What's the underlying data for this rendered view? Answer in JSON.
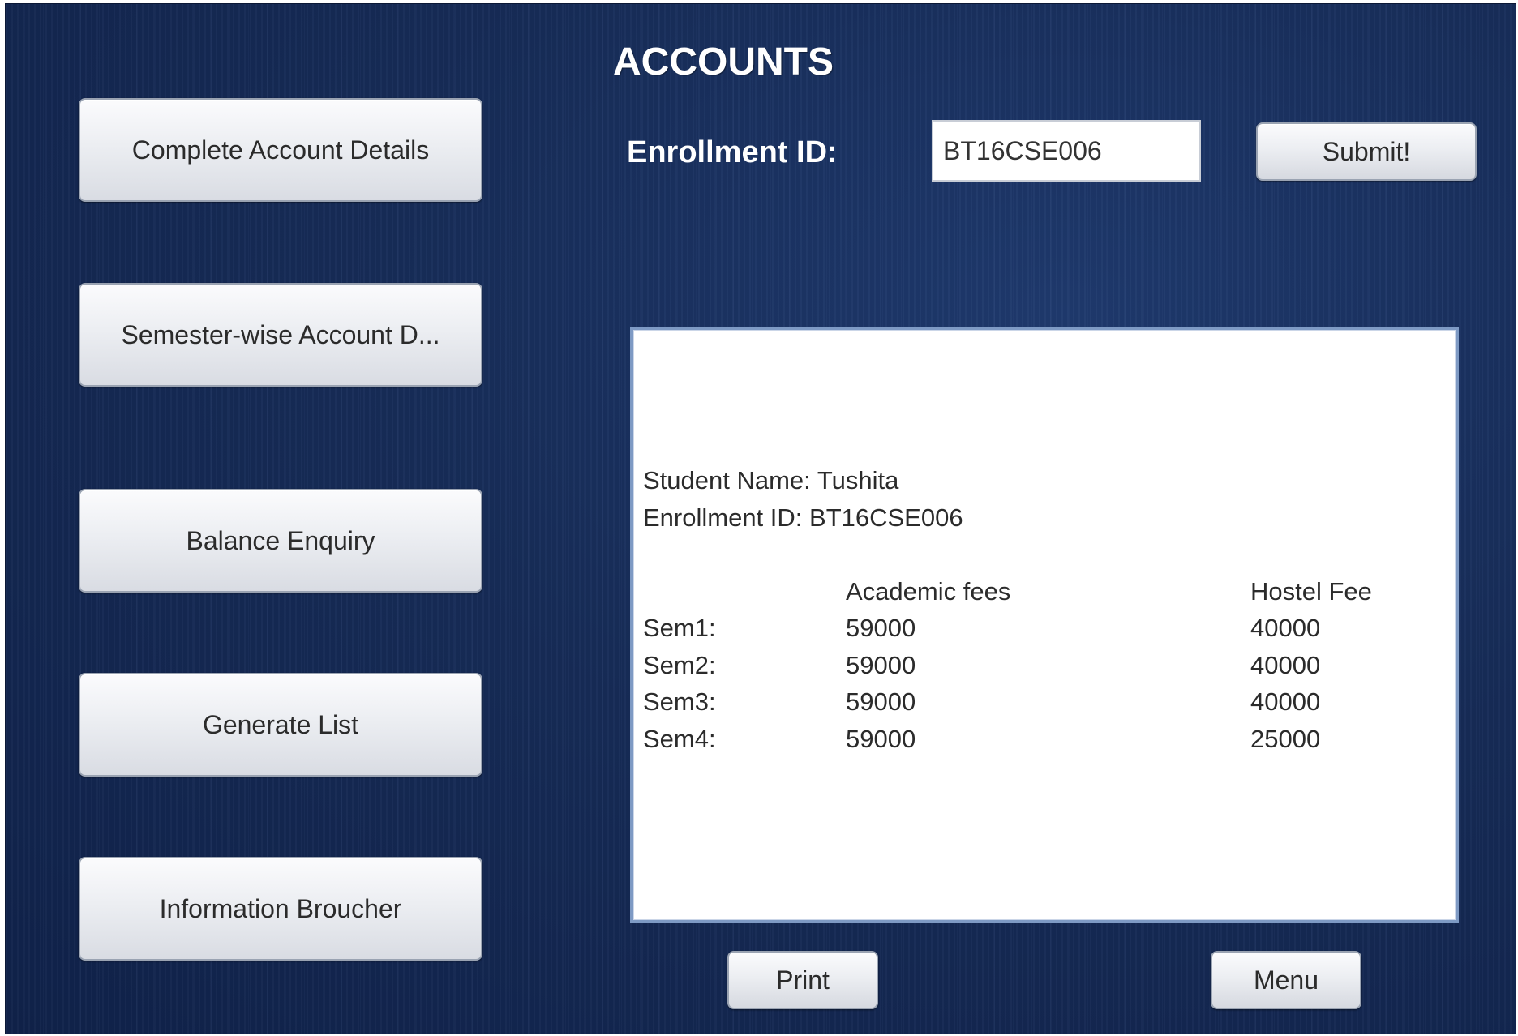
{
  "title": "ACCOUNTS",
  "nav": {
    "complete": "Complete Account Details",
    "semester": "Semester-wise Account D...",
    "balance": "Balance Enquiry",
    "generate": "Generate List",
    "info": "Information Broucher"
  },
  "form": {
    "enrollment_label": "Enrollment ID:",
    "enrollment_value": "BT16CSE006",
    "submit_label": "Submit!"
  },
  "report": {
    "student_name": "Student Name: Tushita",
    "enrollment": "Enrollment ID: BT16CSE006",
    "headers": [
      "",
      "Academic fees",
      "Hostel Fee"
    ],
    "rows": [
      [
        "Sem1:",
        "59000",
        "40000"
      ],
      [
        "Sem2:",
        "59000",
        "40000"
      ],
      [
        "Sem3:",
        "59000",
        "40000"
      ],
      [
        "Sem4:",
        "59000",
        "25000"
      ]
    ]
  },
  "footer": {
    "print_label": "Print",
    "menu_label": "Menu"
  }
}
